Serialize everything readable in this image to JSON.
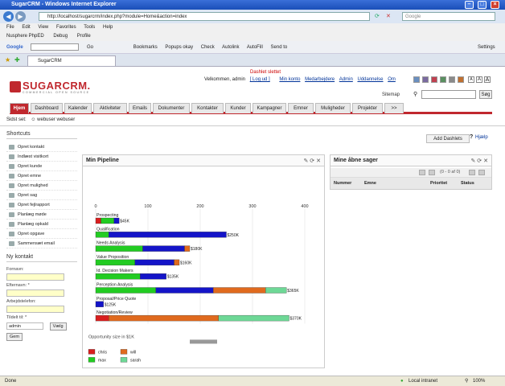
{
  "window": {
    "title": "SugarCRM - Windows Internet Explorer"
  },
  "browser": {
    "url": "http://localhost/sugarcrm/index.php?module=Home&action=index",
    "search_placeholder": "Google",
    "menu": [
      "File",
      "Edit",
      "View",
      "Favorites",
      "Tools",
      "Help"
    ],
    "links": [
      "Nusphere PhpED",
      "Debug",
      "Profile"
    ],
    "google_toolbar": [
      "Google",
      "Go",
      "Bookmarks",
      "Popups okay",
      "Check",
      "Autolink",
      "AutoFill",
      "Send to",
      "Settings"
    ],
    "tab_title": "SugarCRM"
  },
  "app": {
    "logo_text": "SUGARCRM.",
    "logo_sub": "COMMERCIAL OPEN SOURCE",
    "notice": "Dashlet slettet",
    "welcome": "Velkommen, admin",
    "logout": "[ Log ud ]",
    "user_links": [
      "Min konto",
      "Medarbejdere",
      "Admin",
      "Uddannelse",
      "Om"
    ],
    "font_buttons": [
      "A",
      "A",
      "A"
    ],
    "theme_colors": [
      "#6a8fc0",
      "#7a6aa0",
      "#c04050",
      "#5a9060",
      "#8a8a8a",
      "#c07030"
    ],
    "sitemap": "Sitemap",
    "search_button": "Søg",
    "nav_tabs": [
      "Hjem",
      "Dashboard",
      "Kalender",
      "Aktiviteter",
      "Emails",
      "Dokumenter",
      "Kontakter",
      "Kunder",
      "Kampagner",
      "Emner",
      "Muligheder",
      "Projekter",
      ">>"
    ],
    "last_viewed_label": "Sidst set:",
    "last_viewed_item": "webuser webuser",
    "shortcuts_title": "Shortcuts",
    "shortcuts": [
      "Opret kontakt",
      "Indlæst visitkort",
      "Opret kunde",
      "Opret emne",
      "Opret mulighed",
      "Opret sag",
      "Opret fejlrapport",
      "Planlæg møde",
      "Planlæg opkald",
      "Opret opgave",
      "Sammensæt email"
    ],
    "new_contact": {
      "title": "Ny kontakt",
      "first_name": "Fornavn:",
      "last_name": "Efternavn: *",
      "phone": "Arbejdstelefon:",
      "assigned": "Tildelt til: *",
      "assigned_value": "admin",
      "select_button": "Vælg",
      "save_button": "Gem"
    },
    "add_dashlets": "Add Dashlets",
    "help": "Hjælp",
    "pipeline_title": "Min Pipeline",
    "cases_title": "Mine åbne sager",
    "cases_paging": "(0 - 0 af 0)",
    "cases_columns": [
      "Nummer",
      "Emne",
      "Prioritet",
      "Status"
    ]
  },
  "chart_data": {
    "type": "bar",
    "orientation": "horizontal-stacked",
    "xlim": [
      0,
      400
    ],
    "xticks": [
      0,
      100,
      200,
      300,
      400
    ],
    "xlabel": "Opportunity size in $1K",
    "categories": [
      "Prospecting",
      "Qualification",
      "Needs Analysis",
      "Value Proposition",
      "Id. Decision Makers",
      "Perception Analysis",
      "Proposal/Price Quote",
      "Negotiation/Review"
    ],
    "totals": [
      "$45K",
      "$250K",
      "$180K",
      "$160K",
      "$135K",
      "$365K",
      "$125K",
      "$370K"
    ],
    "series": [
      {
        "name": "chris",
        "color": "#d81e1e",
        "values": [
          10,
          0,
          0,
          0,
          0,
          0,
          0,
          25
        ]
      },
      {
        "name": "max",
        "color": "#22cc22",
        "values": [
          25,
          25,
          90,
          75,
          85,
          115,
          0,
          0
        ]
      },
      {
        "name": "sally",
        "color": "#1414c8",
        "values": [
          10,
          225,
          80,
          75,
          50,
          110,
          15,
          0
        ]
      },
      {
        "name": "will",
        "color": "#e06a1e",
        "values": [
          0,
          0,
          10,
          10,
          0,
          100,
          0,
          210
        ]
      },
      {
        "name": "sarah",
        "color": "#6ed896",
        "values": [
          0,
          0,
          0,
          0,
          0,
          40,
          0,
          135
        ]
      },
      {
        "name": "",
        "color": "#1414c8",
        "values": [
          0,
          0,
          0,
          0,
          0,
          0,
          0,
          0
        ]
      }
    ],
    "legend": [
      {
        "name": "chris",
        "color": "#d81e1e"
      },
      {
        "name": "will",
        "color": "#e06a1e"
      },
      {
        "name": "max",
        "color": "#22cc22"
      },
      {
        "name": "sarah",
        "color": "#6ed896"
      },
      {
        "name": "sally",
        "color": "#1414c8"
      }
    ],
    "legend_position": "bottom-left"
  },
  "statusbar": {
    "left": "Done",
    "zone": "Local intranet",
    "zoom": "100%"
  }
}
